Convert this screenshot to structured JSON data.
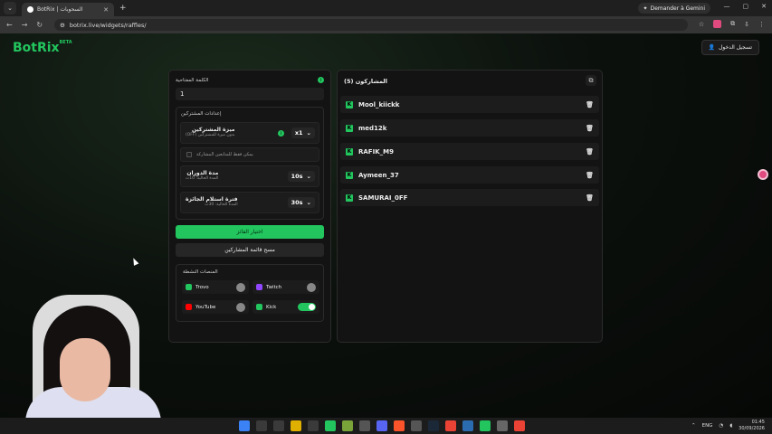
{
  "browser": {
    "tab_title": "BotRix | السحوبات",
    "gemini_label": "Demander à Gemini",
    "url": "botrix.live/widgets/raffles/"
  },
  "header": {
    "logo": "BotRix",
    "logo_badge": "BETA",
    "login_label": "تسجيل الدخول"
  },
  "settings_panel": {
    "keyword_label": "الكلمة المفتاحية",
    "keyword_value": "1",
    "participant_settings_title": "إعدادات المشتركين",
    "subscriber_bonus": {
      "name": "ميزة المشتركين",
      "desc": "بدون ميزة للمشتركين (OFF)",
      "value": "x1"
    },
    "followers_only_label": "يمكن فقط للمتابعين المشاركة",
    "spin_duration": {
      "name": "مدة الدوران",
      "desc": "المدة الحالية: 10ث",
      "value": "10s"
    },
    "claim_time": {
      "name": "فترة استلام الجائزة",
      "desc": "المدة الحالية: 30ث",
      "value": "30s"
    },
    "pick_winner_label": "اختيار الفائز",
    "clear_list_label": "مسح قائمة المشاركين",
    "platforms_title": "المنصات النشطة",
    "platforms": [
      {
        "name": "Trovo",
        "enabled": false,
        "color": "#22c55e"
      },
      {
        "name": "Twitch",
        "enabled": false,
        "color": "#9146ff"
      },
      {
        "name": "YouTube",
        "enabled": false,
        "color": "#ff0000"
      },
      {
        "name": "Kick",
        "enabled": true,
        "color": "#22c55e"
      }
    ]
  },
  "participants_panel": {
    "title": "المشاركون (5)",
    "participants": [
      "Mool_kiickk",
      "med12k",
      "RAFIK_M9",
      "Aymeen_37",
      "SAMURAI_0FF"
    ]
  },
  "taskbar": {
    "lang": "ENG",
    "time": "01:45",
    "date": "30/09/2026"
  }
}
